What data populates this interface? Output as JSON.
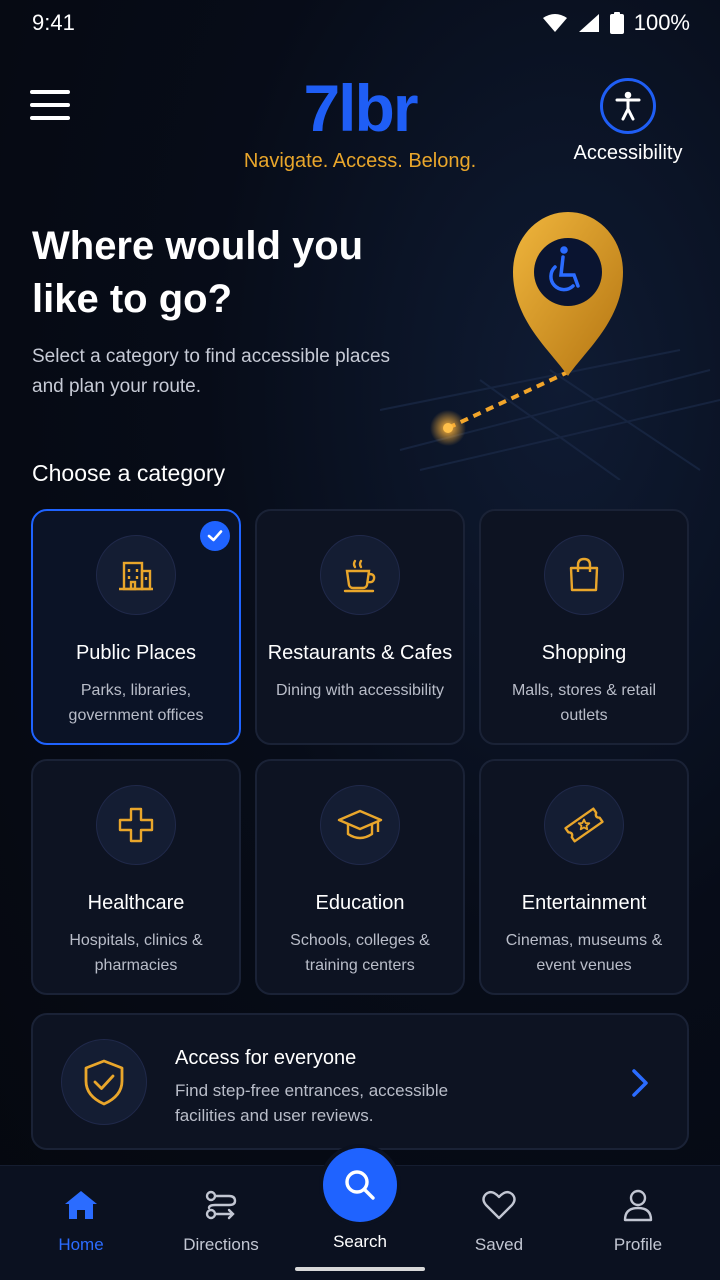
{
  "status_bar": {
    "time": "9:41",
    "battery": "100%"
  },
  "header": {
    "logo": "7lbr",
    "tagline": "Navigate. Access. Belong.",
    "accessibility_label": "Accessibility"
  },
  "hero": {
    "title": "Where would you like to go?",
    "subtitle": "Select a category to find accessible places and plan your route."
  },
  "categories": {
    "heading": "Choose a category",
    "items": [
      {
        "title": "Public Places",
        "desc": "Parks, libraries, government offices",
        "icon": "building-icon",
        "selected": true
      },
      {
        "title": "Restaurants & Cafes",
        "desc": "Dining with accessibility",
        "icon": "coffee-cup-icon",
        "selected": false
      },
      {
        "title": "Shopping",
        "desc": "Malls, stores & retail outlets",
        "icon": "shopping-bag-icon",
        "selected": false
      },
      {
        "title": "Healthcare",
        "desc": "Hospitals, clinics & pharmacies",
        "icon": "medical-cross-icon",
        "selected": false
      },
      {
        "title": "Education",
        "desc": "Schools, colleges & training centers",
        "icon": "graduation-cap-icon",
        "selected": false
      },
      {
        "title": "Entertainment",
        "desc": "Cinemas, museums & event venues",
        "icon": "ticket-icon",
        "selected": false
      }
    ]
  },
  "banner": {
    "title": "Access for everyone",
    "desc": "Find step-free entrances, accessible facilities and user reviews."
  },
  "nav": {
    "home": "Home",
    "directions": "Directions",
    "search": "Search",
    "saved": "Saved",
    "profile": "Profile"
  },
  "colors": {
    "accent_blue": "#1f63ff",
    "accent_gold": "#e9a62b",
    "background": "#060a14"
  }
}
